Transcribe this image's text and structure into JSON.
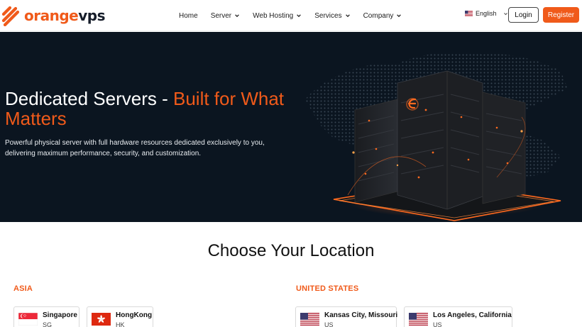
{
  "brand": {
    "name_part1": "orange",
    "name_part2": "vps",
    "accent_color": "#f05a1a",
    "dark_color": "#161d2a"
  },
  "nav": {
    "items": [
      {
        "label": "Home",
        "has_dropdown": false
      },
      {
        "label": "Server",
        "has_dropdown": true
      },
      {
        "label": "Web Hosting",
        "has_dropdown": true
      },
      {
        "label": "Services",
        "has_dropdown": true
      },
      {
        "label": "Company",
        "has_dropdown": true
      }
    ],
    "language": "English",
    "login_label": "Login",
    "register_label": "Register"
  },
  "hero": {
    "title_main": "Dedicated Servers - ",
    "title_accent": "Built for What Matters",
    "description": "Powerful physical server with full hardware resources dedicated exclusively to you, delivering maximum performance, security, and customization.",
    "background_color": "#0b1520"
  },
  "locations": {
    "heading": "Choose Your Location",
    "regions": [
      {
        "name": "ASIA",
        "cards": [
          {
            "name": "Singapore",
            "code": "SG",
            "flag_icon": "singapore-flag-icon"
          },
          {
            "name": "HongKong",
            "code": "HK",
            "flag_icon": "hongkong-flag-icon"
          }
        ]
      },
      {
        "name": "UNITED STATES",
        "cards": [
          {
            "name": "Kansas City, Missouri",
            "code": "US",
            "flag_icon": "us-flag-icon"
          },
          {
            "name": "Los Angeles, California",
            "code": "US",
            "flag_icon": "us-flag-icon"
          }
        ]
      }
    ]
  }
}
